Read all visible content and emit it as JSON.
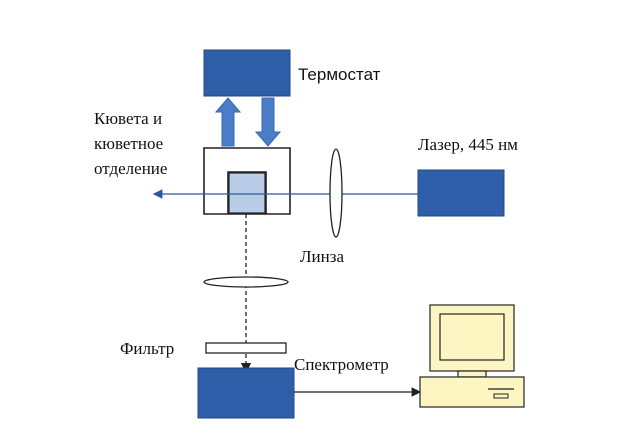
{
  "labels": {
    "thermostat": "Термостат",
    "cuvette_line1": "Кювета и",
    "cuvette_line2": "кюветное",
    "cuvette_line3": "отделение",
    "laser": "Лазер, 445 нм",
    "lens": "Линза",
    "filter": "Фильтр",
    "spectrometer": "Спектрометр"
  },
  "colors": {
    "block_fill": "#2f5fa8",
    "block_stroke": "#1f4a8a",
    "arrow_fill": "#4a7cc7",
    "cuvette_fill": "#b9cde9",
    "beam": "#2b57a5",
    "computer_fill": "#fdf6c2",
    "outline": "#222222"
  },
  "icons": {
    "computer": "desktop-computer-icon"
  }
}
